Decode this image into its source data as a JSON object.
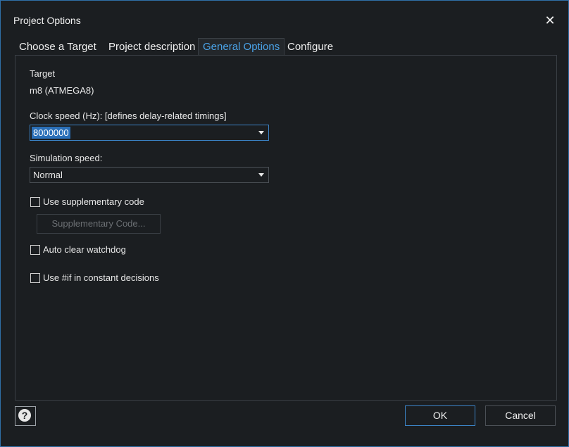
{
  "window": {
    "title": "Project Options",
    "close_glyph": "✕"
  },
  "tabs": [
    {
      "label": "Choose a Target",
      "active": false
    },
    {
      "label": "Project description",
      "active": false
    },
    {
      "label": "General Options",
      "active": true
    },
    {
      "label": "Configure",
      "active": false
    }
  ],
  "general": {
    "target_label": "Target",
    "target_value": "m8 (ATMEGA8)",
    "clock_label": "Clock speed (Hz): [defines delay-related timings]",
    "clock_value": "8000000",
    "sim_label": "Simulation speed:",
    "sim_value": "Normal",
    "supp_code_label": "Use supplementary code",
    "supp_code_checked": false,
    "supp_code_button": "Supplementary Code...",
    "watchdog_label": "Auto clear watchdog",
    "watchdog_checked": false,
    "ifdef_label": "Use #if in constant decisions",
    "ifdef_checked": false
  },
  "footer": {
    "help_glyph": "?",
    "ok_label": "OK",
    "cancel_label": "Cancel"
  },
  "colors": {
    "accent": "#4aa3e8",
    "background": "#1b1e21",
    "border": "#2f6fa8"
  }
}
